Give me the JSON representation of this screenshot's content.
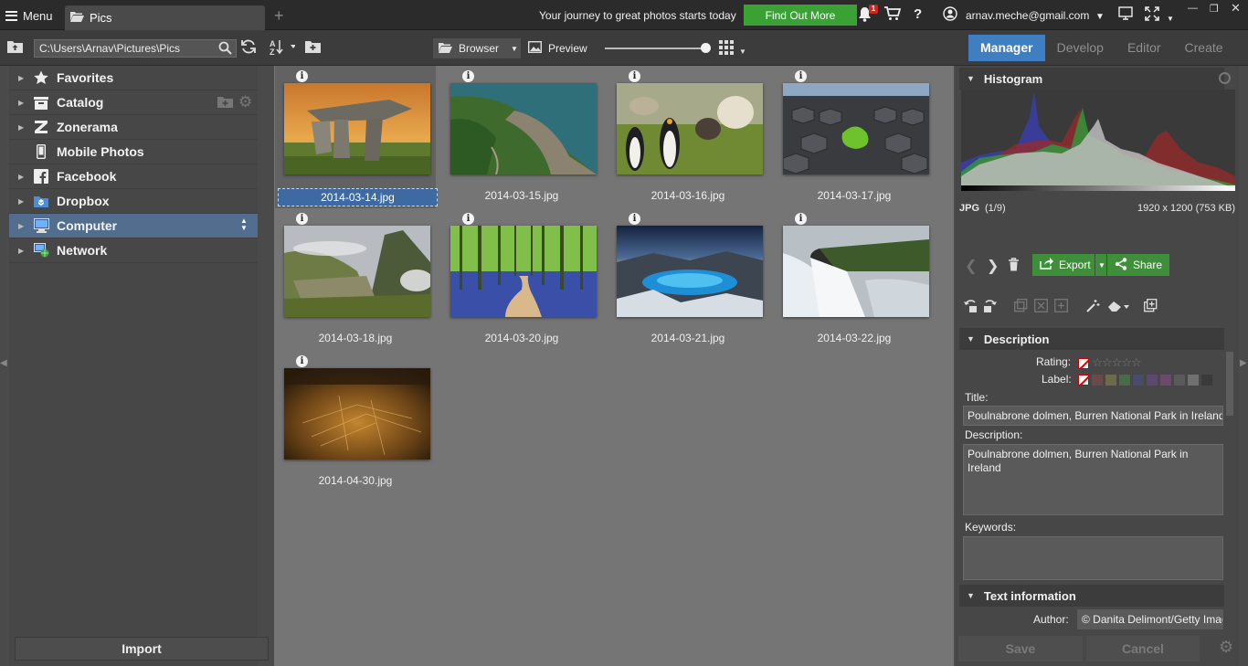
{
  "topbar": {
    "menu_label": "Menu",
    "tab_label": "Pics",
    "promo_text": "Your journey to great photos starts today",
    "promo_button": "Find Out More",
    "notification_count": "1",
    "user_email": "arnav.meche@gmail.com"
  },
  "toolbar": {
    "path": "C:\\Users\\Arnav\\Pictures\\Pics",
    "browser_label": "Browser",
    "preview_label": "Preview"
  },
  "mode_tabs": [
    "Manager",
    "Develop",
    "Editor",
    "Create"
  ],
  "sidebar": {
    "items": [
      {
        "label": "Favorites",
        "icon": "star-icon"
      },
      {
        "label": "Catalog",
        "icon": "catalog-icon"
      },
      {
        "label": "Zonerama",
        "icon": "zonerama-icon"
      },
      {
        "label": "Mobile Photos",
        "icon": "mobile-icon"
      },
      {
        "label": "Facebook",
        "icon": "facebook-icon"
      },
      {
        "label": "Dropbox",
        "icon": "dropbox-icon"
      },
      {
        "label": "Computer",
        "icon": "computer-icon"
      },
      {
        "label": "Network",
        "icon": "network-icon"
      }
    ],
    "import_label": "Import"
  },
  "thumbnails": [
    {
      "file": "2014-03-14.jpg"
    },
    {
      "file": "2014-03-15.jpg"
    },
    {
      "file": "2014-03-16.jpg"
    },
    {
      "file": "2014-03-17.jpg"
    },
    {
      "file": "2014-03-18.jpg"
    },
    {
      "file": "2014-03-20.jpg"
    },
    {
      "file": "2014-03-21.jpg"
    },
    {
      "file": "2014-03-22.jpg"
    },
    {
      "file": "2014-04-30.jpg"
    }
  ],
  "right_panel": {
    "histogram_title": "Histogram",
    "file_type": "JPG",
    "file_index": "(1/9)",
    "file_dims": "1920 x 1200 (753 KB)",
    "export_label": "Export",
    "share_label": "Share",
    "description_title": "Description",
    "rating_label": "Rating:",
    "label_label": "Label:",
    "title_label": "Title:",
    "title_value": "Poulnabrone dolmen, Burren National Park in Ireland",
    "description_label": "Description:",
    "description_value": "Poulnabrone dolmen, Burren National Park in Ireland",
    "keywords_label": "Keywords:",
    "keywords_value": "",
    "text_info_title": "Text information",
    "author_label": "Author:",
    "author_value": "© Danita Delimont/Getty Images",
    "save_label": "Save",
    "cancel_label": "Cancel"
  },
  "colors": {
    "accent": "#3f7ec0",
    "green_button": "#3aa135",
    "selection": "#536d8f"
  }
}
